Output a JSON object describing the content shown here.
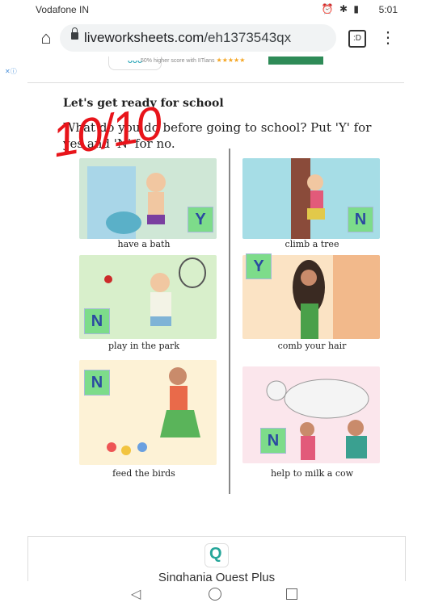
{
  "status_bar": {
    "carrier": "Vodafone IN",
    "time": "5:01"
  },
  "browser": {
    "url_domain": "liveworksheets.com",
    "url_path": "/eh1373543qx",
    "tabs_label": ":D"
  },
  "ad": {
    "text": "50% higher score with IITians"
  },
  "worksheet": {
    "heading": "Let's get ready for school",
    "question": "What do you do before going to school? Put 'Y' for yes and 'N' for no.",
    "score": "10/10",
    "items": [
      {
        "caption": "have a bath",
        "answer": "Y"
      },
      {
        "caption": "climb a tree",
        "answer": "N"
      },
      {
        "caption": "play in the park",
        "answer": "N"
      },
      {
        "caption": "comb your hair",
        "answer": "Y"
      },
      {
        "caption": "feed the birds",
        "answer": "N"
      },
      {
        "caption": "help to milk a cow",
        "answer": "N"
      }
    ]
  },
  "bottom_card": {
    "title": "Singhania Quest Plus"
  }
}
